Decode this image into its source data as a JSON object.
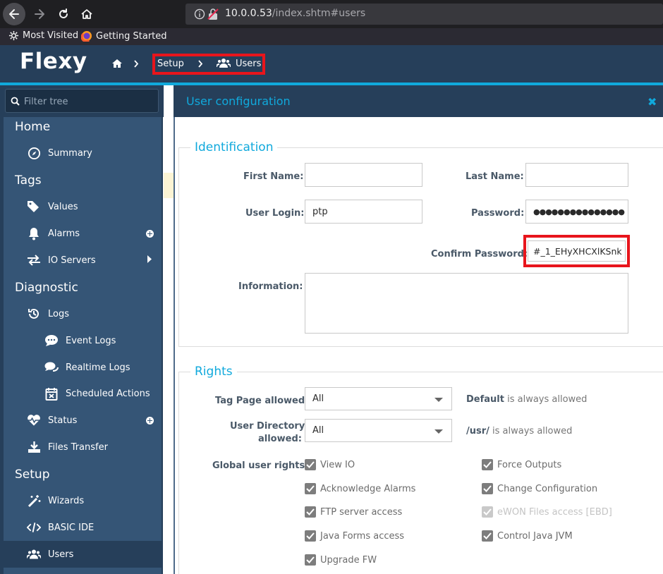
{
  "browser": {
    "url_host": "10.0.0.53",
    "url_path": "/index.shtm#users",
    "bookmarks": [
      {
        "label": "Most Visited",
        "icon": "gear-icon"
      },
      {
        "label": "Getting Started",
        "icon": "firefox-icon"
      }
    ]
  },
  "header": {
    "logo": "Flexy",
    "breadcrumb": [
      {
        "label": "Setup"
      },
      {
        "label": "Users",
        "icon": "users-icon"
      }
    ]
  },
  "sidebar": {
    "filter_placeholder": "Filter tree",
    "sections": [
      {
        "title": "Home",
        "items": [
          {
            "label": "Summary",
            "icon": "compass-icon"
          }
        ]
      },
      {
        "title": "Tags",
        "items": [
          {
            "label": "Values",
            "icon": "tags-icon"
          },
          {
            "label": "Alarms",
            "icon": "bell-icon"
          },
          {
            "label": "IO Servers",
            "icon": "exchange-icon"
          }
        ]
      },
      {
        "title": "Diagnostic",
        "items": [
          {
            "label": "Logs",
            "icon": "history-icon"
          },
          {
            "label": "Event Logs",
            "icon": "comment-icon"
          },
          {
            "label": "Realtime Logs",
            "icon": "comments-icon"
          },
          {
            "label": "Scheduled Actions",
            "icon": "calendar-x-icon"
          },
          {
            "label": "Status",
            "icon": "heartbeat-icon"
          },
          {
            "label": "Files Transfer",
            "icon": "download-icon"
          }
        ]
      },
      {
        "title": "Setup",
        "items": [
          {
            "label": "Wizards",
            "icon": "magic-wand-icon"
          },
          {
            "label": "BASIC IDE",
            "icon": "code-icon"
          },
          {
            "label": "Users",
            "icon": "users-icon"
          }
        ]
      }
    ]
  },
  "modal": {
    "title": "User configuration",
    "identification": {
      "legend": "Identification",
      "first_name_label": "First Name:",
      "first_name_value": "",
      "last_name_label": "Last Name:",
      "last_name_value": "",
      "user_login_label": "User Login:",
      "user_login_value": "ptp",
      "password_label": "Password:",
      "password_value": "●●●●●●●●●●●●●●●",
      "confirm_password_label": "Confirm Password:",
      "confirm_password_value": "#_1_EHyXHCXlKSnk",
      "information_label": "Information:",
      "information_value": ""
    },
    "rights": {
      "legend": "Rights",
      "tag_page_label": "Tag Page allowed:",
      "tag_page_value": "All",
      "tag_page_note_bold": "Default",
      "tag_page_note": " is always allowed",
      "user_dir_label_1": "User Directory",
      "user_dir_label_2": "allowed:",
      "user_dir_value": "All",
      "user_dir_note_bold": "/usr/",
      "user_dir_note": " is always allowed",
      "global_label": "Global user rights:",
      "checkboxes_left": [
        {
          "label": "View IO",
          "checked": true
        },
        {
          "label": "Acknowledge Alarms",
          "checked": true
        },
        {
          "label": "FTP server access",
          "checked": true
        },
        {
          "label": "Java Forms access",
          "checked": true
        },
        {
          "label": "Upgrade FW",
          "checked": true
        }
      ],
      "checkboxes_right": [
        {
          "label": "Force Outputs",
          "checked": true
        },
        {
          "label": "Change Configuration",
          "checked": true
        },
        {
          "label": "eWON Files access [EBD]",
          "checked": true,
          "disabled": true
        },
        {
          "label": "Control Java JVM",
          "checked": true
        }
      ]
    }
  },
  "colors": {
    "header_bg": "#263f5a",
    "accent": "#10a9dc",
    "highlight": "#e8151c"
  }
}
